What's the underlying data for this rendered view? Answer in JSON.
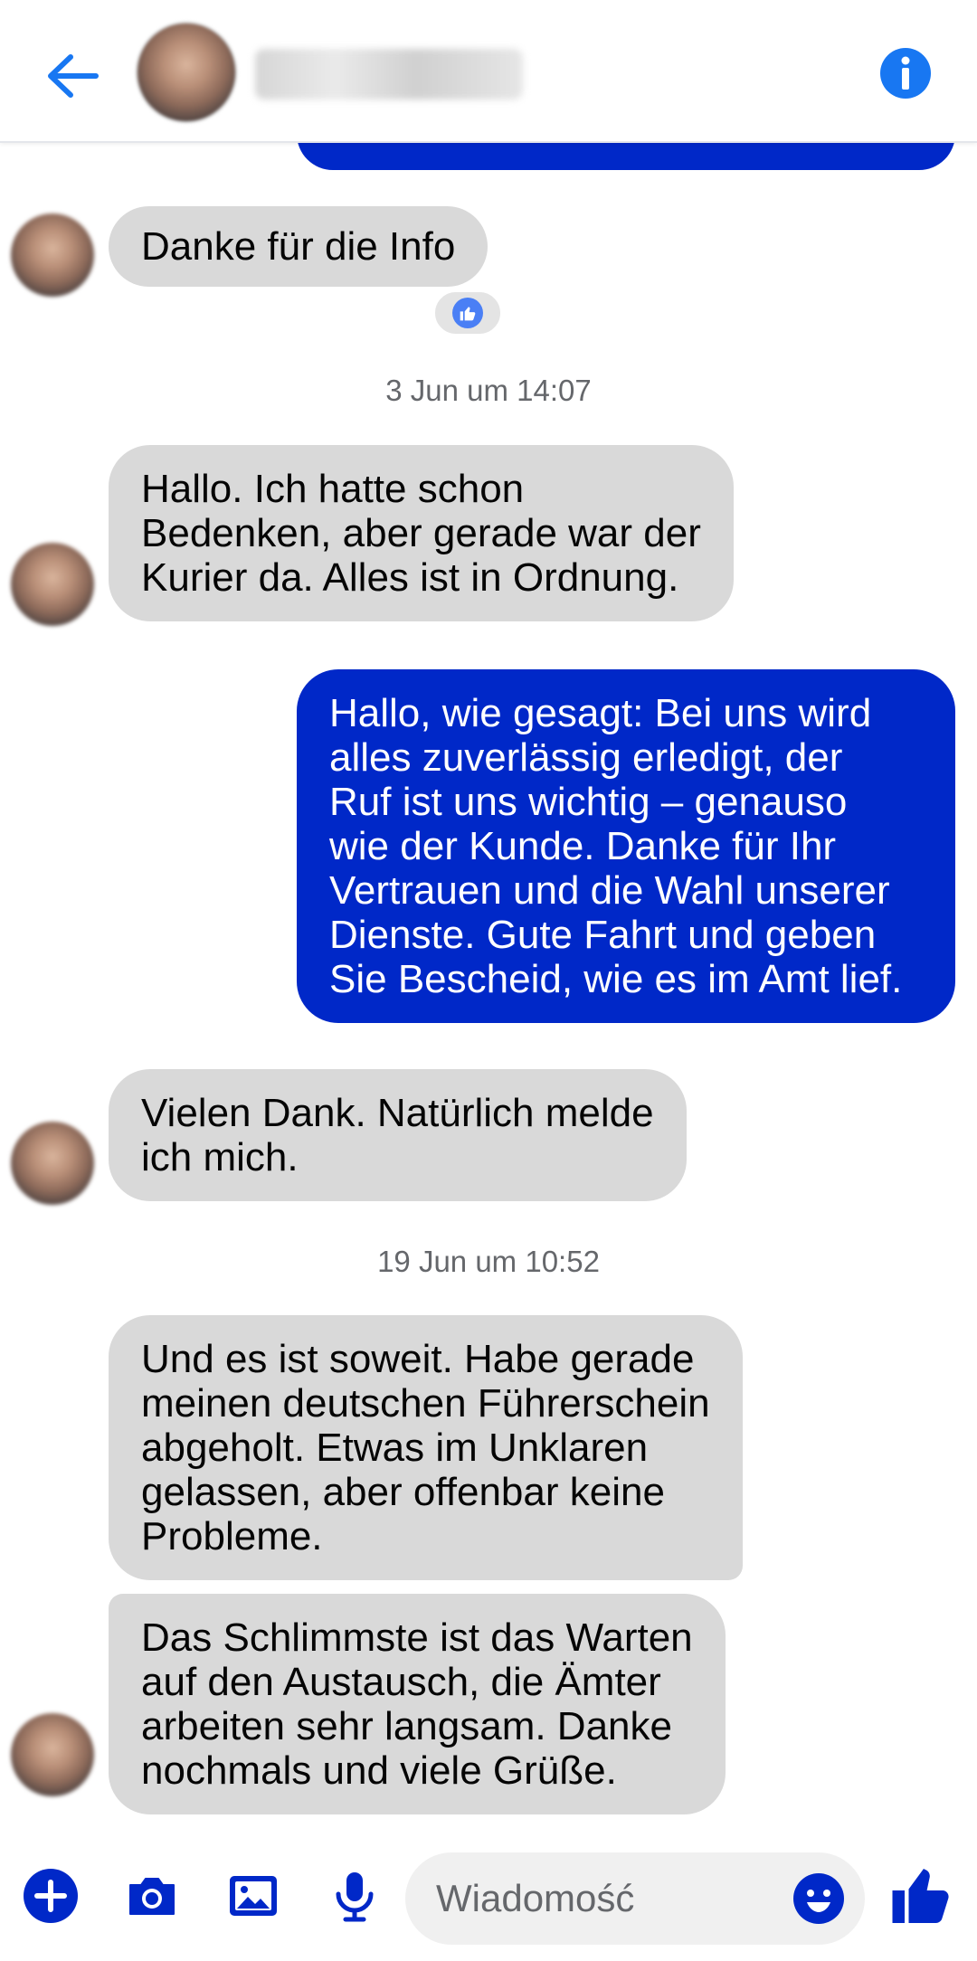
{
  "colors": {
    "accent": "#0028c8",
    "icon_blue": "#1877f2",
    "incoming_bubble": "#d9d9d9",
    "timestamp": "#65676b"
  },
  "header": {
    "back_icon": "arrow-left-icon",
    "avatar": "contact-avatar-blurred",
    "contact_name_blurred": true,
    "info_icon": "info-icon"
  },
  "messages": [
    {
      "direction": "in",
      "text": "Danke für die Info",
      "reaction": "thumbs-up-icon"
    },
    {
      "timestamp": "3 Jun um 14:07"
    },
    {
      "direction": "in",
      "text": "Hallo. Ich hatte schon\nBedenken, aber gerade war der\nKurier da. Alles ist in Ordnung."
    },
    {
      "direction": "out",
      "text": "Hallo, wie gesagt: Bei uns wird\nalles zuverlässig erledigt, der\nRuf ist uns wichtig – genauso\nwie der Kunde. Danke für Ihr\nVertrauen und die Wahl unserer\nDienste. Gute Fahrt und geben\nSie Bescheid, wie es im Amt lief."
    },
    {
      "direction": "in",
      "text": "Vielen Dank. Natürlich melde\nich mich."
    },
    {
      "timestamp": "19 Jun um 10:52"
    },
    {
      "direction": "in",
      "text": "Und es ist soweit. Habe gerade\nmeinen deutschen Führerschein\nabgeholt. Etwas im Unklaren\ngelassen, aber offenbar keine\nProbleme."
    },
    {
      "direction": "in",
      "text": "Das Schlimmste ist das Warten\nauf den Austausch, die Ämter\narbeiten sehr langsam. Danke\nnochmals und viele Grüße."
    }
  ],
  "composer": {
    "icons": [
      "plus-icon",
      "camera-icon",
      "image-icon",
      "microphone-icon"
    ],
    "placeholder": "Wiadomość",
    "emoji_icon": "emoji-icon",
    "send_icon": "thumbs-up-icon"
  }
}
